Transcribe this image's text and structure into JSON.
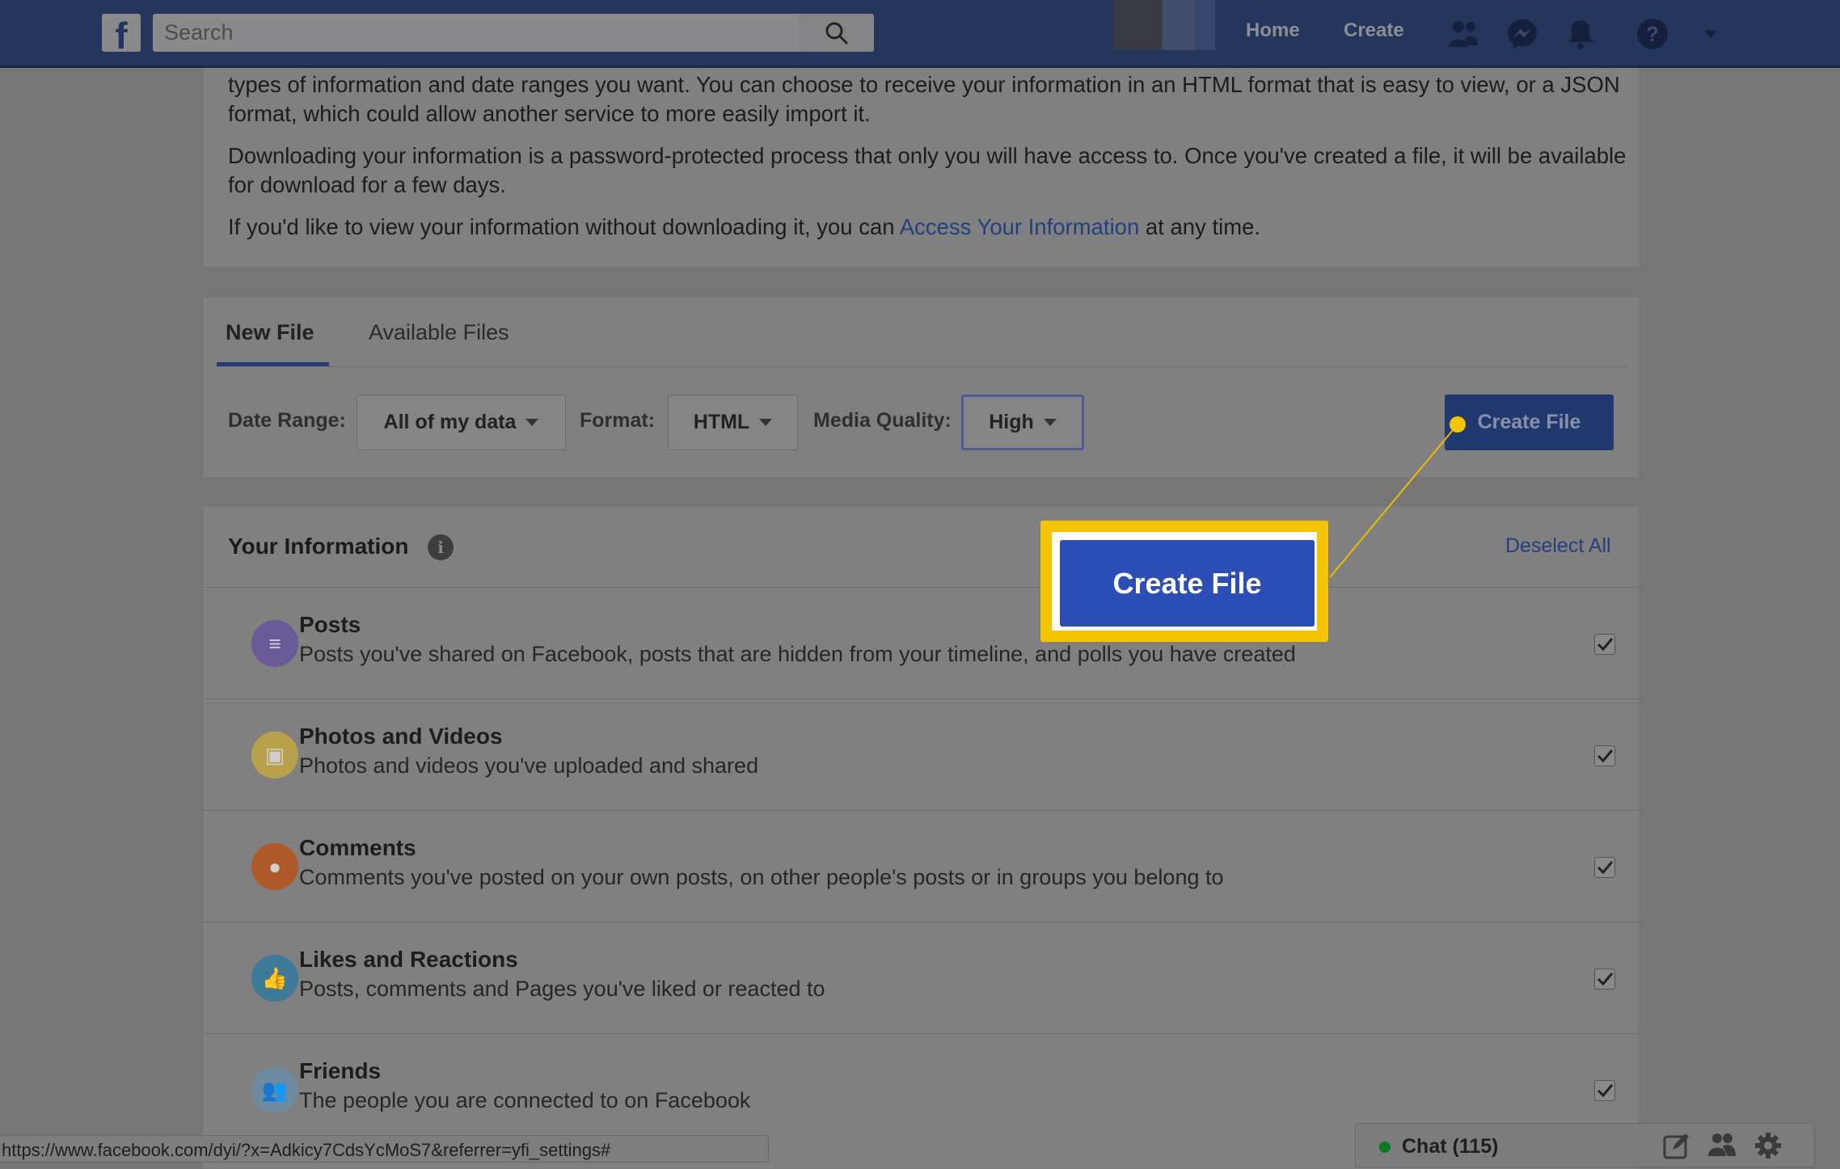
{
  "header": {
    "logo": "f",
    "search_placeholder": "Search",
    "nav": [
      "Home",
      "Create"
    ],
    "icons": [
      "friends-icon",
      "messenger-icon",
      "notifications-icon",
      "help-icon",
      "menu-caret-icon"
    ]
  },
  "intro": {
    "line1": "types of information and date ranges you want. You can choose to receive your information in an HTML format that is easy to view, or a JSON format, which could allow another service to more easily import it.",
    "line2": "Downloading your information is a password-protected process that only you will have access to. Once you've created a file, it will be available for download for a few days.",
    "line3_pre": "If you'd like to view your information without downloading it, you can ",
    "line3_link": "Access Your Information",
    "line3_post": " at any time."
  },
  "tabs": [
    {
      "label": "New File",
      "active": true
    },
    {
      "label": "Available Files",
      "active": false
    }
  ],
  "filters": {
    "date_label": "Date Range:",
    "date_value": "All of my data",
    "format_label": "Format:",
    "format_value": "HTML",
    "quality_label": "Media Quality:",
    "quality_value": "High",
    "create_button": "Create File"
  },
  "info": {
    "title": "Your Information",
    "deselect": "Deselect All",
    "items": [
      {
        "title": "Posts",
        "desc": "Posts you've shared on Facebook, posts that are hidden from your timeline, and polls you have created",
        "color": "#6a5a98",
        "checked": true
      },
      {
        "title": "Photos and Videos",
        "desc": "Photos and videos you've uploaded and shared",
        "color": "#b8a14a",
        "checked": true
      },
      {
        "title": "Comments",
        "desc": "Comments you've posted on your own posts, on other people's posts or in groups you belong to",
        "color": "#b0592a",
        "checked": true
      },
      {
        "title": "Likes and Reactions",
        "desc": "Posts, comments and Pages you've liked or reacted to",
        "color": "#3d7a9a",
        "checked": true
      },
      {
        "title": "Friends",
        "desc": "The people you are connected to on Facebook",
        "color": "#6e8aa0",
        "checked": true
      }
    ]
  },
  "callout": {
    "label": "Create File",
    "highlight_color": "#f5c400",
    "button_color": "#2d4fb5"
  },
  "status_url": "https://www.facebook.com/dyi/?x=Adkicy7CdsYcMoS7&referrer=yfi_settings#",
  "chat": {
    "label": "Chat (115)",
    "online_color": "#0a7a1e"
  }
}
